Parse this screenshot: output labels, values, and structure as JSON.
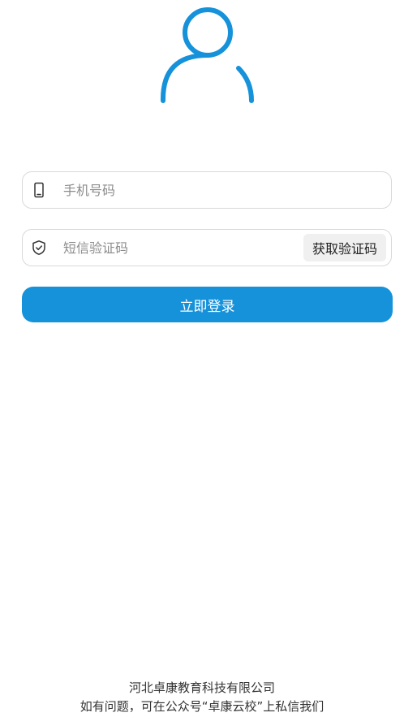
{
  "form": {
    "phone_placeholder": "手机号码",
    "code_placeholder": "短信验证码",
    "get_code_label": "获取验证码",
    "login_label": "立即登录"
  },
  "footer": {
    "company": "河北卓康教育科技有限公司",
    "help": "如有问题，可在公众号“卓康云校”上私信我们"
  },
  "icons": {
    "avatar": "user-avatar-icon",
    "phone": "mobile-phone-icon",
    "code": "shield-check-icon"
  },
  "colors": {
    "accent": "#1592da",
    "field_border": "#d9d9d9",
    "get_code_bg": "#f0f0f0"
  }
}
